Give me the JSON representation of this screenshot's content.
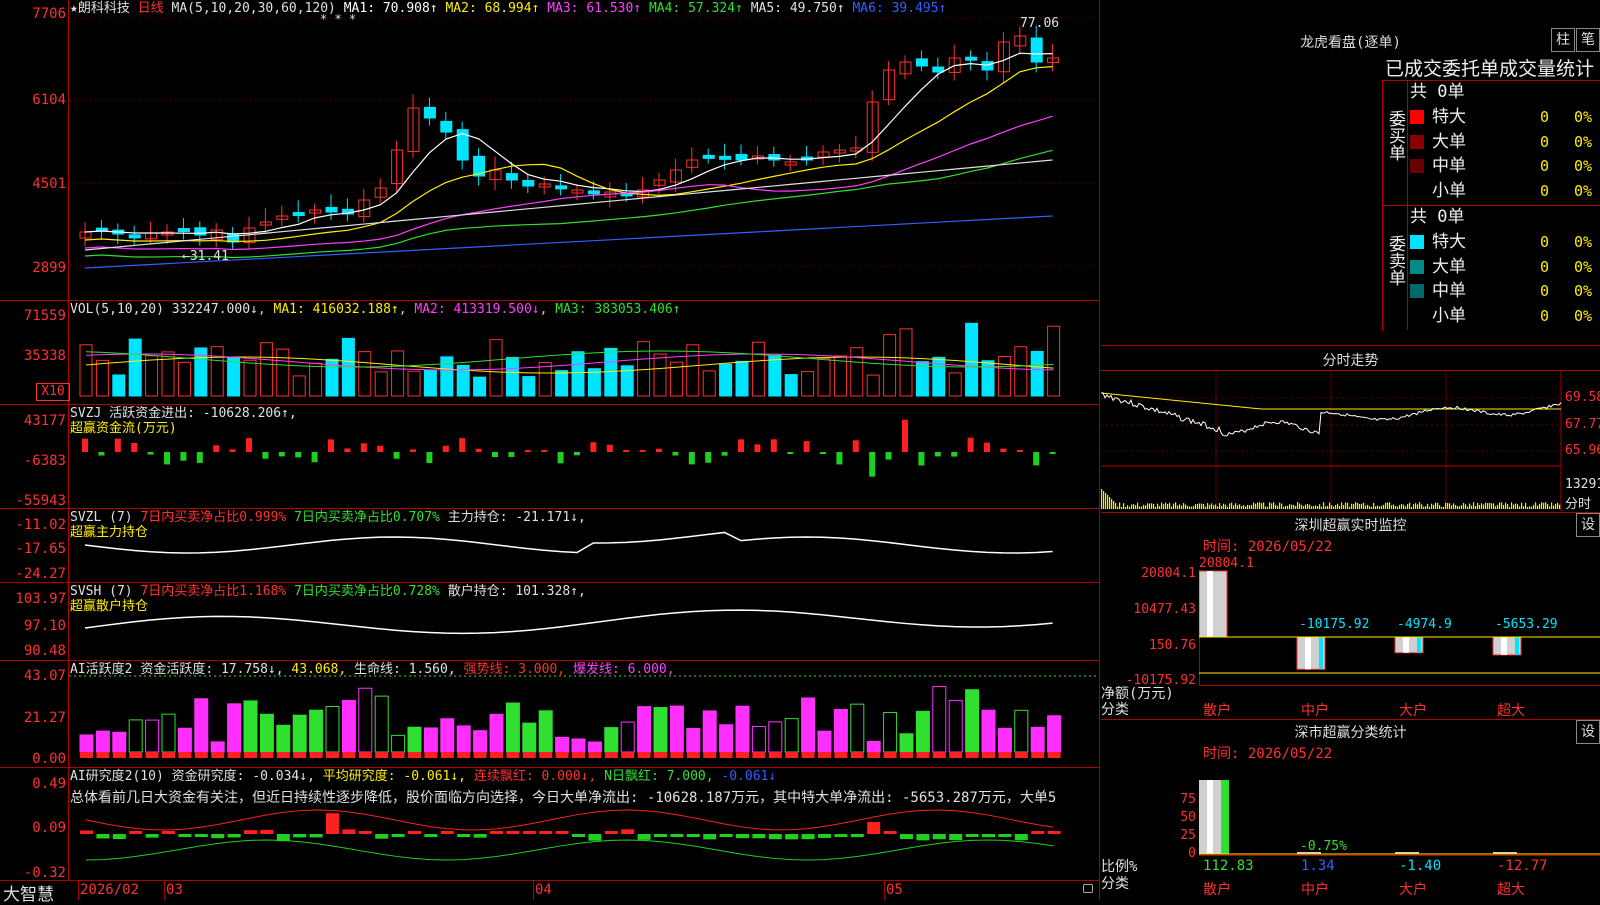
{
  "main": {
    "axis": [
      "7706",
      "6104",
      "4501",
      "2899"
    ],
    "title_star": "★",
    "stock_name": "朗科科技",
    "period": "日线",
    "ma_params": "MA(5,10,20,30,60,120)",
    "ma": [
      {
        "label": "MA1: 70.908↑",
        "color": "#ffffff"
      },
      {
        "label": "MA2: 68.994↑",
        "color": "#ffee00"
      },
      {
        "label": "MA3: 61.530↑",
        "color": "#ff40ff"
      },
      {
        "label": "MA4: 57.324↑",
        "color": "#30e030"
      },
      {
        "label": "MA5: 49.750↑",
        "color": "#e0e0e0"
      },
      {
        "label": "MA6: 39.495↑",
        "color": "#3060ff"
      }
    ],
    "high_label": "77.06",
    "low_label": "31.41",
    "marks": "* * *"
  },
  "vol": {
    "axis": [
      "71559",
      "35338"
    ],
    "unit": "X10",
    "params": "VOL(5,10,20)",
    "value": "332247.000↓",
    "ma1": "MA1: 416032.188↑",
    "ma2": "MA2: 413319.500↓",
    "ma3": "MA3: 383053.406↑"
  },
  "svzj": {
    "axis": [
      "43177",
      "-6383",
      "-55943"
    ],
    "line1": "SVZJ  活跃资金进出: -10628.206↑,",
    "line2": "超赢资金流(万元)"
  },
  "svzl": {
    "axis": [
      "-11.02",
      "-17.65",
      "-24.27"
    ],
    "name": "SVZL (7)",
    "a": "7日内买卖净占比0.999%",
    "b": "7日内买卖净占比0.707%",
    "c": "主力持仓: -21.171↓,",
    "line2": "超赢主力持仓"
  },
  "svsh": {
    "axis": [
      "103.97",
      "97.10",
      "90.48"
    ],
    "name": "SVSH (7)",
    "a": "7日内买卖净占比1.168%",
    "b": "7日内买卖净占比0.728%",
    "c": "散户持仓: 101.328↑,",
    "line2": "超赢散户持仓"
  },
  "ai2": {
    "axis": [
      "43.07",
      "21.27",
      "0.00"
    ],
    "name": "AI活跃度2",
    "a": "资金活跃度: 17.758↓,",
    "b": "43.068,",
    "c": "生命线: 1.560,",
    "d": "强势线: 3.000,",
    "e": "爆发线: 6.000,"
  },
  "ai_research": {
    "axis": [
      "0.49",
      "0.09",
      "-0.32"
    ],
    "name": "AI研究度2(10)",
    "a": "资金研究度: -0.034↓,",
    "b": "平均研究度: -0.061↓,",
    "c": "连续飘红: 0.000↓,",
    "d": "N日飘红: 7.000,",
    "e": "-0.061↓",
    "comment": "总体看前几日大资金有关注，但近日持续性逐步降低，股价面临方向选择，今日大单净流出: -10628.187万元，其中特大单净流出: -5653.287万元，大单5"
  },
  "bottom": {
    "brand": "大智慧",
    "dates": [
      "2026/02",
      "03",
      "04",
      "05"
    ]
  },
  "lhb": {
    "title": "龙虎看盘(逐单)",
    "btn1": "柱",
    "btn2": "笔",
    "subtitle": "已成交委托单成交量统计",
    "buy_label": "委买单",
    "sell_label": "委卖单",
    "buy_total": "共 0单",
    "sell_total": "共 0单",
    "buy_rows": [
      {
        "name": "特大",
        "count": "0",
        "pct": "0%",
        "color": "#ff0000"
      },
      {
        "name": "大单",
        "count": "0",
        "pct": "0%",
        "color": "#8a0000"
      },
      {
        "name": "中单",
        "count": "0",
        "pct": "0%",
        "color": "#6a0000"
      },
      {
        "name": "小单",
        "count": "0",
        "pct": "0%",
        "color": "#000000"
      }
    ],
    "sell_rows": [
      {
        "name": "特大",
        "count": "0",
        "pct": "0%",
        "color": "#00e5ff"
      },
      {
        "name": "大单",
        "count": "0",
        "pct": "0%",
        "color": "#008a8a"
      },
      {
        "name": "中单",
        "count": "0",
        "pct": "0%",
        "color": "#006a6a"
      },
      {
        "name": "小单",
        "count": "0",
        "pct": "0%",
        "color": "#000000"
      }
    ]
  },
  "fenshi": {
    "title": "分时走势",
    "right_labels": [
      "69.58",
      "67.77",
      "65.96",
      "13291",
      "分时"
    ]
  },
  "sz_monitor": {
    "title": "深圳超赢实时监控",
    "btn": "设",
    "time": "时间: 2026/05/22",
    "top_value": "20804.1",
    "axis": [
      "20804.1",
      "10477.43",
      "150.76",
      "-10175.92"
    ],
    "unit_label": "净额(万元)",
    "cat_label": "分类",
    "bars": [
      {
        "name": "散户",
        "value": "20804.1"
      },
      {
        "name": "中户",
        "value": "-10175.92"
      },
      {
        "name": "大户",
        "value": "-4974.9"
      },
      {
        "name": "超大",
        "value": "-5653.29"
      }
    ]
  },
  "sz_stats": {
    "title": "深市超赢分类统计",
    "btn": "设",
    "time": "时间: 2026/05/22",
    "axis": [
      "75",
      "50",
      "25",
      "0"
    ],
    "unit_label": "比例%",
    "cat_label": "分类",
    "mid_label": "-0.75%",
    "bars": [
      {
        "name": "散户",
        "value": "112.83"
      },
      {
        "name": "中户",
        "value": "1.34"
      },
      {
        "name": "大户",
        "value": "-1.40"
      },
      {
        "name": "超大",
        "value": "-12.77"
      }
    ]
  }
}
